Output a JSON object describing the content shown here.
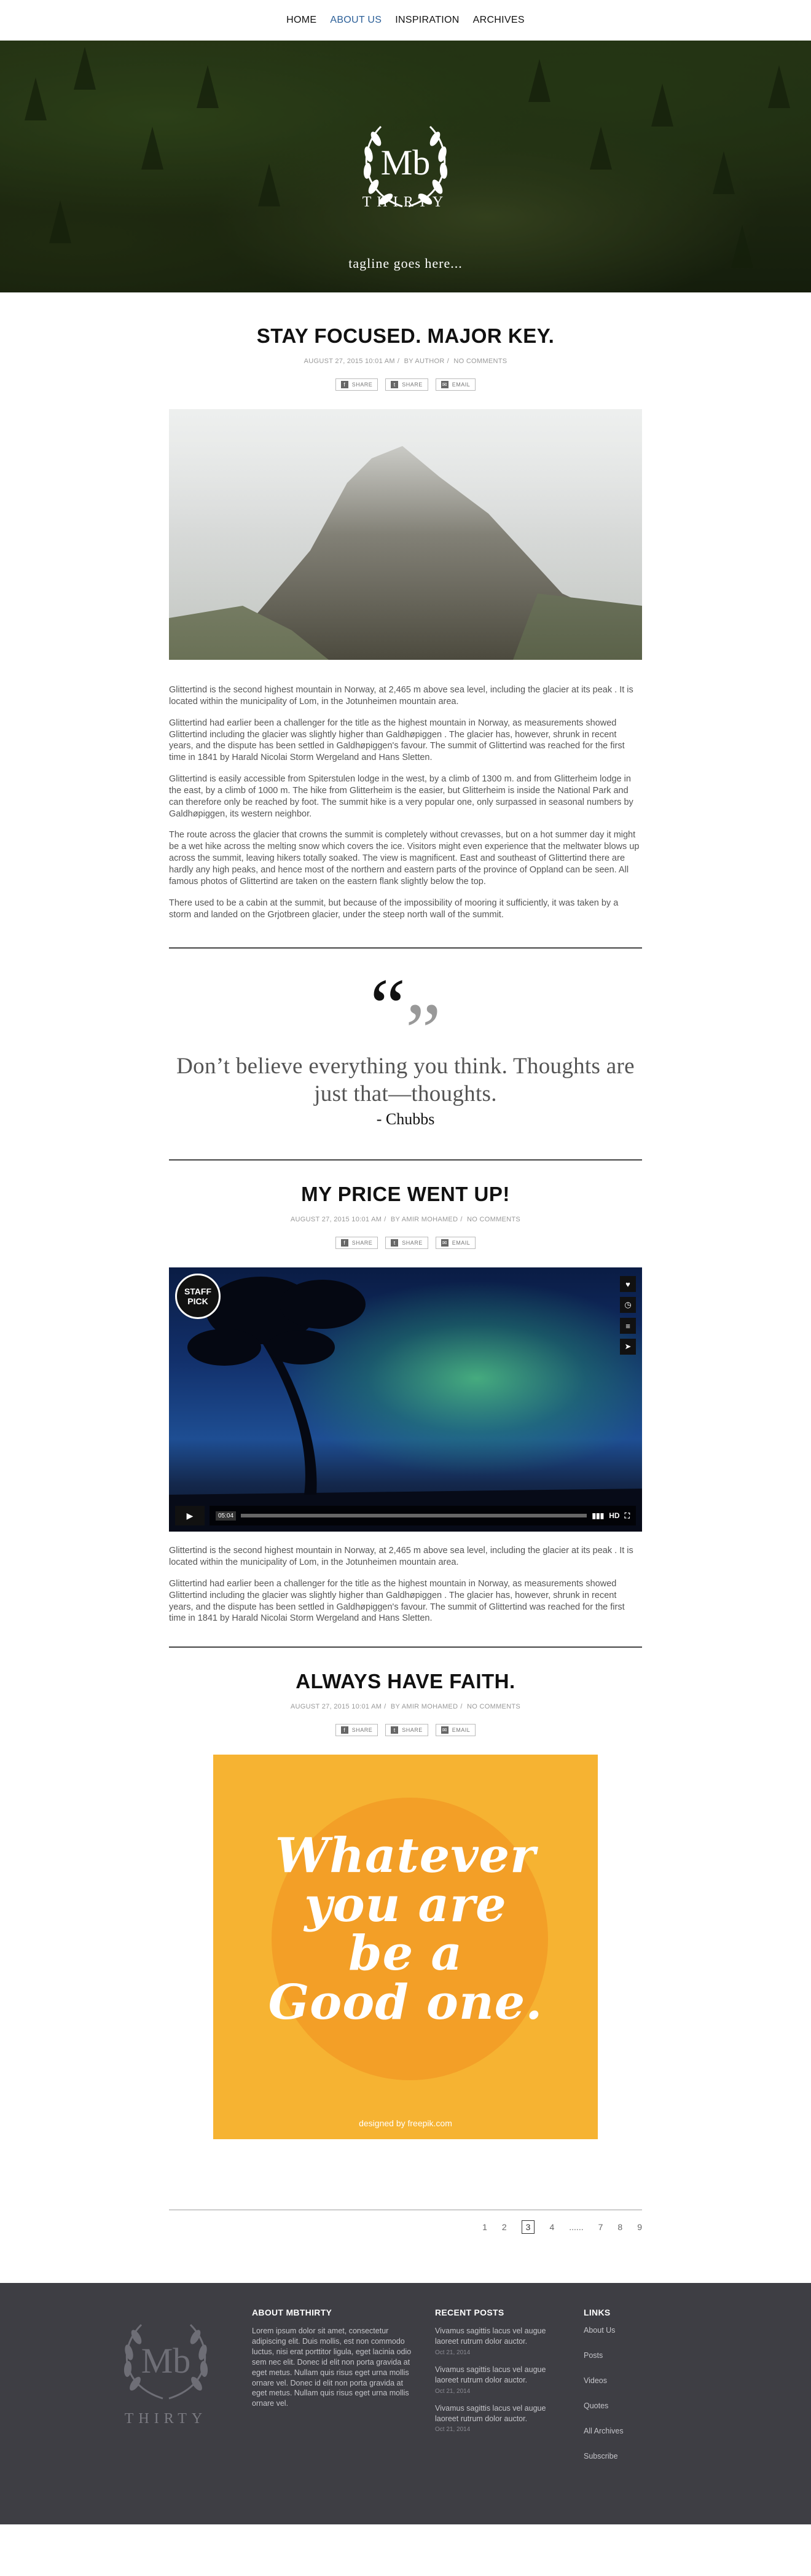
{
  "nav": {
    "items": [
      "HOME",
      "ABOUT US",
      "INSPIRATION",
      "ARCHIVES"
    ],
    "active": "ABOUT US"
  },
  "hero": {
    "logo": "Mb",
    "thirty": "THIRTY",
    "tagline": "tagline goes here..."
  },
  "posts": [
    {
      "title": "STAY FOCUSED. MAJOR KEY.",
      "date": "AUGUST 27, 2015 10:01 AM",
      "author": "BY AUTHOR",
      "comments": "NO COMMENTS",
      "share": [
        "SHARE",
        "SHARE",
        "EMAIL"
      ],
      "paragraphs": [
        "Glittertind is the second highest mountain in Norway, at 2,465 m above sea level, including the glacier at its peak . It is located within the municipality of Lom, in the Jotunheimen mountain area.",
        "Glittertind had earlier been a challenger for the title as the highest mountain in Norway, as measurements showed Glittertind including the glacier was slightly higher than Galdhøpiggen . The glacier has, however, shrunk in recent years, and the dispute has been settled in Galdhøpiggen's favour. The summit of Glittertind was reached for the first time in 1841 by Harald Nicolai Storm Wergeland and Hans Sletten.",
        "Glittertind is easily accessible from Spiterstulen lodge in the west, by a climb of 1300 m. and from Glitterheim lodge in the east, by a climb of 1000 m. The hike from Glitterheim is the easier, but Glitterheim is inside the National Park and can therefore only be reached by foot. The summit hike is a very popular one, only surpassed in seasonal numbers by Galdhøpiggen, its western neighbor.",
        "The route across the glacier that crowns the summit is completely without crevasses, but on a hot summer day it might be a wet hike across the melting snow which covers the ice. Visitors might even experience that the meltwater blows up across the summit, leaving hikers totally soaked. The view is magnificent. East and southeast of Glittertind there are hardly any high peaks, and hence most of the northern and eastern parts of the province of Oppland can be seen. All famous photos of Glittertind are taken on the eastern flank slightly below the top.",
        "There used to be a cabin at the summit, but because of the impossibility of mooring it sufficiently, it was taken by a storm and landed on the Grjotbreen glacier, under the steep north wall of the summit."
      ]
    },
    {
      "title": "MY PRICE WENT UP!",
      "date": "AUGUST 27, 2015 10:01 AM",
      "author": "BY AMIR MOHAMED",
      "comments": "NO COMMENTS",
      "share": [
        "SHARE",
        "SHARE",
        "EMAIL"
      ],
      "video": {
        "badge_line1": "STAFF",
        "badge_line2": "PICK",
        "time": "05:04",
        "hd": "HD"
      },
      "paragraphs": [
        "Glittertind is the second highest mountain in Norway, at 2,465 m above sea level, including the glacier at its peak . It is located within the municipality of Lom, in the Jotunheimen mountain area.",
        "Glittertind had earlier been a challenger for the title as the highest mountain in Norway, as measurements showed Glittertind including the glacier was slightly higher than Galdhøpiggen . The glacier has, however, shrunk in recent years, and the dispute has been settled in Galdhøpiggen's favour. The summit of Glittertind was reached for the first time in 1841 by Harald Nicolai Storm Wergeland and Hans Sletten."
      ]
    },
    {
      "title": "ALWAYS HAVE FAITH.",
      "date": "AUGUST 27, 2015 10:01 AM",
      "author": "BY AMIR MOHAMED",
      "comments": "NO COMMENTS",
      "share": [
        "SHARE",
        "SHARE",
        "EMAIL"
      ],
      "image_text": [
        "Whatever",
        "you are",
        "be a",
        "Good one."
      ],
      "credit": "designed by freepik.com"
    }
  ],
  "quote": {
    "marks_open": "“",
    "marks_close": "”",
    "text": "Don’t believe everything you think. Thoughts are just that—thoughts.",
    "author": "- Chubbs"
  },
  "pagination": {
    "pages": [
      "1",
      "2",
      "3",
      "4",
      "......",
      "7",
      "8",
      "9"
    ],
    "current": "3"
  },
  "footer": {
    "logo": "Mb",
    "thirty": "THIRTY",
    "about": {
      "title": "ABOUT MBTHIRTY",
      "text": "Lorem ipsum dolor sit amet, consectetur adipiscing elit. Duis mollis, est non commodo luctus, nisi erat porttitor ligula, eget lacinia odio sem nec elit. Donec id elit non porta gravida at eget metus. Nullam quis risus eget urna mollis ornare vel. Donec id elit non porta gravida at eget metus. Nullam quis risus eget urna mollis ornare vel."
    },
    "recent": {
      "title": "RECENT POSTS",
      "items": [
        {
          "text": "Vivamus sagittis lacus vel augue laoreet rutrum dolor auctor.",
          "date": "Oct 21, 2014"
        },
        {
          "text": "Vivamus sagittis lacus vel augue laoreet rutrum dolor auctor.",
          "date": "Oct 21, 2014"
        },
        {
          "text": "Vivamus sagittis lacus vel augue laoreet rutrum dolor auctor.",
          "date": "Oct 21, 2014"
        }
      ]
    },
    "links": {
      "title": "LINKS",
      "items": [
        "About Us",
        "Posts",
        "Videos",
        "Quotes",
        "All Archives",
        "Subscribe"
      ]
    }
  }
}
